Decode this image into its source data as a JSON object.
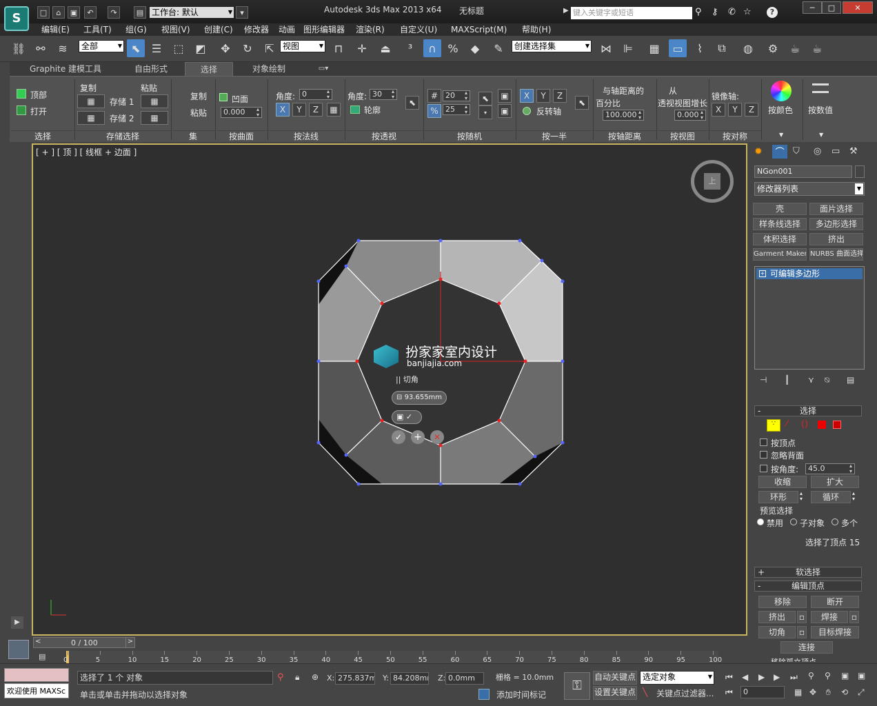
{
  "title": {
    "app": "Autodesk 3ds Max  2013 x64",
    "doc": "无标题",
    "workspace": "工作台: 默认",
    "search_placeholder": "键入关键字或短语"
  },
  "menu": [
    "编辑(E)",
    "工具(T)",
    "组(G)",
    "视图(V)",
    "创建(C)",
    "修改器",
    "动画",
    "图形编辑器",
    "渲染(R)",
    "自定义(U)",
    "MAXScript(M)",
    "帮助(H)"
  ],
  "toolbar": {
    "filter": "全部",
    "refcoord": "视图",
    "selset": "创建选择集"
  },
  "ribbon": {
    "tabs": [
      "Graphite 建模工具",
      "自由形式",
      "选择",
      "对象绘制"
    ],
    "active_tab": "选择",
    "groups": [
      "选择",
      "存储选择",
      "集",
      "按曲面",
      "按法线",
      "按透视",
      "按随机",
      "按一半",
      "按轴距离",
      "按视图",
      "按对称",
      "按颜色",
      "按数值"
    ],
    "top_label": "顶部",
    "open_label": "打开",
    "copy_label": "复制",
    "paste_label": "粘贴",
    "store1": "存储 1",
    "store2": "存储 2",
    "set_copy": "复制",
    "set_paste": "粘贴",
    "concave": "凹面",
    "concave_val": "0.000",
    "normal_angle_label": "角度:",
    "normal_angle": "0",
    "persp_angle_label": "角度:",
    "persp_angle": "30",
    "outline": "轮廓",
    "rand_num": "20",
    "rand_pct": "25",
    "half_invert": "反转轴",
    "axis_dist_l1": "与轴距离的",
    "axis_dist_l2": "百分比",
    "axis_dist_val": "100.000",
    "view_l1": "从",
    "view_l2": "透视视图增长",
    "view_val": "0.000",
    "mirror_axis": "镜像轴:",
    "x": "X",
    "y": "Y",
    "z": "Z"
  },
  "viewport": {
    "label": "[ + ] [ 顶 ] [ 线框 + 边面 ]",
    "caddy_title": "|| 切角",
    "caddy_value": "93.655mm",
    "watermark_cn": "扮家家室内设计",
    "watermark_en": "banjiajia.com",
    "viewcube_label": "上"
  },
  "command_panel": {
    "object_name": "NGon001",
    "modifier_list": "修改器列表",
    "buttons": [
      "壳",
      "面片选择",
      "样条线选择",
      "多边形选择",
      "体积选择",
      "挤出",
      "Garment Maker",
      "NURBS 曲面选择"
    ],
    "stack_item": "可编辑多边形",
    "selection_title": "选择",
    "by_vertex": "按顶点",
    "ignore_backface": "忽略背面",
    "by_angle": "按角度:",
    "angle_val": "45.0",
    "shrink": "收缩",
    "grow": "扩大",
    "ring": "环形",
    "loop": "循环",
    "preview_title": "预览选择",
    "preview_opts": [
      "禁用",
      "子对象",
      "多个"
    ],
    "sel_info": "选择了顶点 15",
    "soft_sel": "软选择",
    "edit_vertices": "编辑顶点",
    "remove": "移除",
    "break": "断开",
    "extrude": "挤出",
    "weld": "焊接",
    "chamfer": "切角",
    "target_weld": "目标焊接",
    "connect": "连接",
    "cut_off": "移除孤立顶点"
  },
  "timeline": {
    "frame": "0 / 100",
    "ticks": [
      "0",
      "5",
      "10",
      "15",
      "20",
      "25",
      "30",
      "35",
      "40",
      "45",
      "50",
      "55",
      "60",
      "65",
      "70",
      "75",
      "80",
      "85",
      "90",
      "95",
      "100"
    ]
  },
  "status": {
    "maxscript": "欢迎使用 MAXSc",
    "line1": "选择了 1 个 对象",
    "line2": "单击或单击并拖动以选择对象",
    "x_label": "X:",
    "x": "275.837mm",
    "y_label": "Y:",
    "y": "84.208mm",
    "z_label": "Z:",
    "z": "0.0mm",
    "grid": "栅格 = 10.0mm",
    "add_time_tag": "添加时间标记",
    "auto_key": "自动关键点",
    "set_key": "设置关键点",
    "selected": "选定对象",
    "key_filters": "关键点过滤器...",
    "frame_val": "0"
  }
}
